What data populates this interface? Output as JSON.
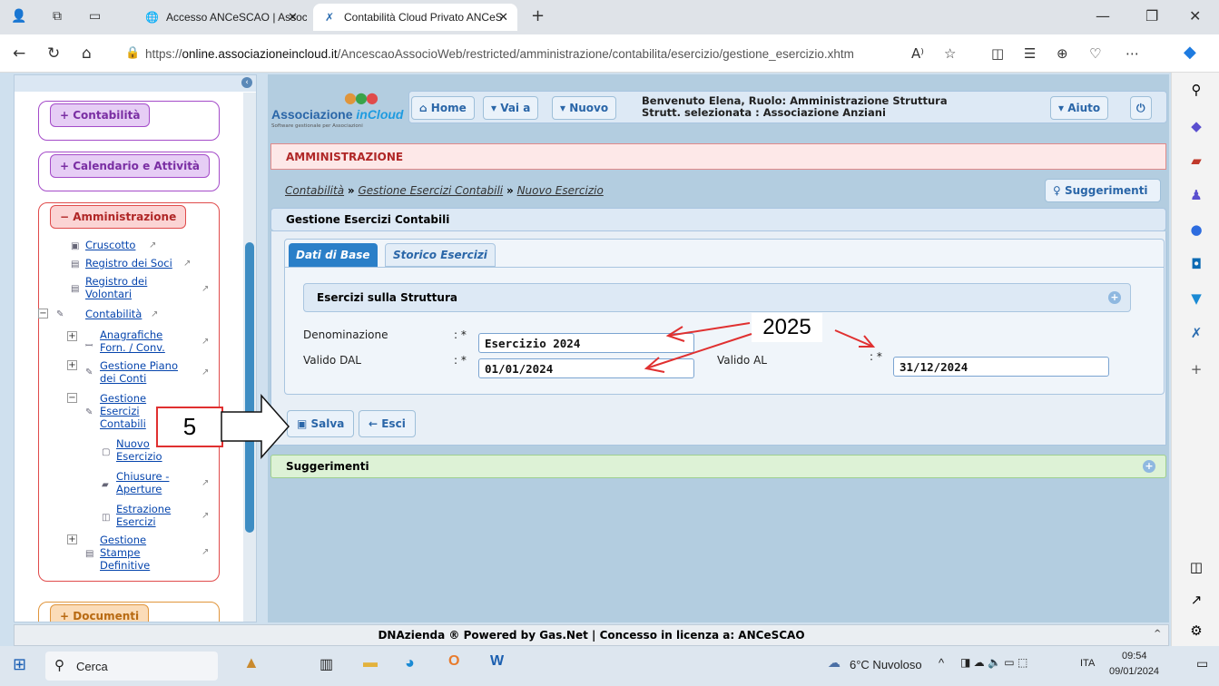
{
  "browser": {
    "tabs": [
      {
        "title": "Accesso ANCeSCAO | Associazio"
      },
      {
        "title": "Contabilità Cloud Privato ANCeS"
      }
    ],
    "url_prefix": "https://",
    "url_domain": "online.associazioneincloud.it",
    "url_path": "/AncescaoAssocioWeb/restricted/amministrazione/contabilita/esercizio/gestione_esercizio.xhtm"
  },
  "header": {
    "logo_text_1": "Associazione ",
    "logo_text_2": "inCloud",
    "logo_subtitle": "Software gestionale per Associazioni",
    "home": "Home",
    "vai_a": "Vai a",
    "nuovo": "Nuovo",
    "welcome_line1": "Benvenuto Elena, Ruolo: Amministrazione Struttura",
    "welcome_line2": "Strutt. selezionata : Associazione Anziani",
    "aiuto": "Aiuto"
  },
  "sidebar": {
    "groups": {
      "contabilita": "Contabilità",
      "calendario": "Calendario e Attività",
      "amministrazione": "Amministrazione",
      "documenti": "Documenti"
    },
    "tree": {
      "cruscotto": "Cruscotto",
      "registro_soci": "Registro dei Soci",
      "registro_volontari_1": "Registro dei",
      "registro_volontari_2": "Volontari",
      "contabilita": "Contabilità",
      "anagrafiche_1": "Anagrafiche",
      "anagrafiche_2": "Forn. / Conv.",
      "piano_conti_1": "Gestione Piano",
      "piano_conti_2": "dei Conti",
      "gest_esercizi_1": "Gestione",
      "gest_esercizi_2": "Esercizi",
      "gest_esercizi_3": "Contabili",
      "nuovo_esercizio_1": "Nuovo",
      "nuovo_esercizio_2": "Esercizio",
      "chiusure_1": "Chiusure -",
      "chiusure_2": "Aperture",
      "estrazione_1": "Estrazione",
      "estrazione_2": "Esercizi",
      "stampe_1": "Gestione",
      "stampe_2": "Stampe",
      "stampe_3": "Definitive"
    }
  },
  "main": {
    "section": "AMMINISTRAZIONE",
    "breadcrumb": [
      "Contabilità",
      "Gestione Esercizi Contabili",
      "Nuovo Esercizio"
    ],
    "breadcrumb_sep": "»",
    "suggerimenti_btn": "Suggerimenti",
    "panel_title": "Gestione Esercizi Contabili",
    "tabs": [
      "Dati di Base",
      "Storico Esercizi"
    ],
    "esercizi_struttura": "Esercizi sulla Struttura",
    "form": {
      "denominazione_label": "Denominazione",
      "denominazione_value": "Esercizio 2024",
      "valido_dal_label": "Valido DAL",
      "valido_dal_value": "01/01/2024",
      "valido_al_label": "Valido AL",
      "valido_al_value": "31/12/2024",
      "required_mark": ": *"
    },
    "salva": "Salva",
    "esci": "Esci",
    "suggerimenti_section": "Suggerimenti"
  },
  "footer": "DNAzienda ® Powered by Gas.Net | Concesso in licenza a: ANCeSCAO",
  "annotations": {
    "step": "5",
    "year": "2025"
  },
  "taskbar": {
    "search": "Cerca",
    "weather": "6°C Nuvoloso",
    "lang": "ITA",
    "time": "09:54",
    "date": "09/01/2024"
  },
  "colors": {
    "accent": "#2a66a8",
    "annotation": "#e03030"
  }
}
